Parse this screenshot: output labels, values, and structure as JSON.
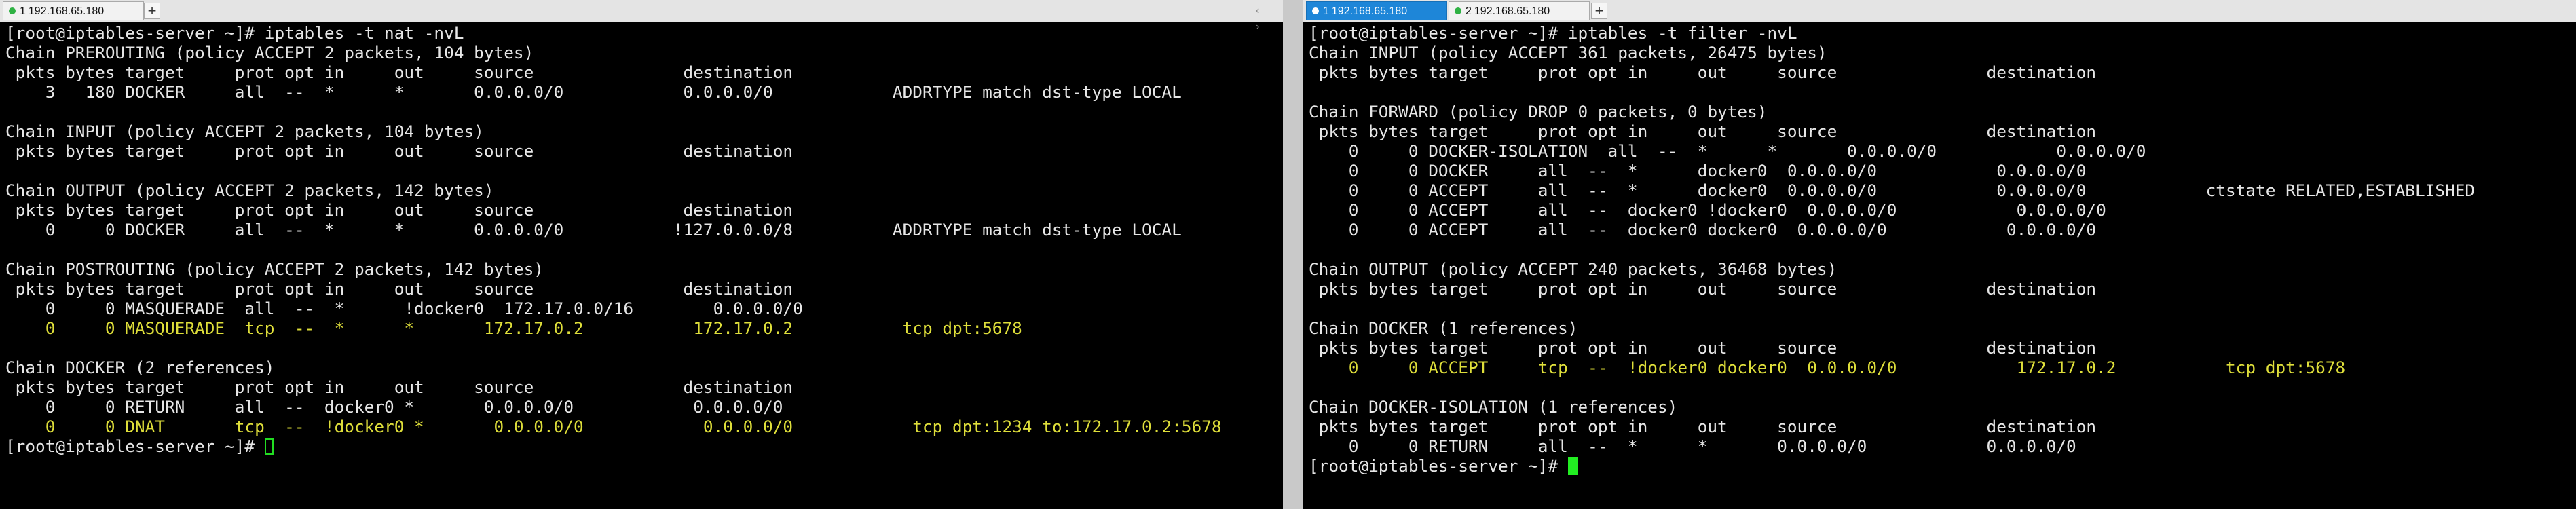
{
  "left_session": {
    "tabs": [
      {
        "number": "1",
        "label": "192.168.65.180",
        "active": false
      }
    ],
    "add_tab": "+",
    "nav_arrows": "‹ ›",
    "terminal_lines": [
      {
        "text": "[root@iptables-server ~]# iptables -t nat -nvL",
        "highlight": false
      },
      {
        "text": "Chain PREROUTING (policy ACCEPT 2 packets, 104 bytes)",
        "highlight": false
      },
      {
        "text": " pkts bytes target     prot opt in     out     source               destination",
        "highlight": false
      },
      {
        "text": "    3   180 DOCKER     all  --  *      *       0.0.0.0/0            0.0.0.0/0            ADDRTYPE match dst-type LOCAL",
        "highlight": false
      },
      {
        "text": "",
        "highlight": false
      },
      {
        "text": "Chain INPUT (policy ACCEPT 2 packets, 104 bytes)",
        "highlight": false
      },
      {
        "text": " pkts bytes target     prot opt in     out     source               destination",
        "highlight": false
      },
      {
        "text": "",
        "highlight": false
      },
      {
        "text": "Chain OUTPUT (policy ACCEPT 2 packets, 142 bytes)",
        "highlight": false
      },
      {
        "text": " pkts bytes target     prot opt in     out     source               destination",
        "highlight": false
      },
      {
        "text": "    0     0 DOCKER     all  --  *      *       0.0.0.0/0           !127.0.0.0/8          ADDRTYPE match dst-type LOCAL",
        "highlight": false
      },
      {
        "text": "",
        "highlight": false
      },
      {
        "text": "Chain POSTROUTING (policy ACCEPT 2 packets, 142 bytes)",
        "highlight": false
      },
      {
        "text": " pkts bytes target     prot opt in     out     source               destination",
        "highlight": false
      },
      {
        "text": "    0     0 MASQUERADE  all  --  *      !docker0  172.17.0.0/16        0.0.0.0/0",
        "highlight": false
      },
      {
        "text": "    0     0 MASQUERADE  tcp  --  *      *       172.17.0.2           172.17.0.2           tcp dpt:5678",
        "highlight": true
      },
      {
        "text": "",
        "highlight": false
      },
      {
        "text": "Chain DOCKER (2 references)",
        "highlight": false
      },
      {
        "text": " pkts bytes target     prot opt in     out     source               destination",
        "highlight": false
      },
      {
        "text": "    0     0 RETURN     all  --  docker0 *       0.0.0.0/0            0.0.0.0/0",
        "highlight": false
      },
      {
        "text": "    0     0 DNAT       tcp  --  !docker0 *       0.0.0.0/0            0.0.0.0/0            tcp dpt:1234 to:172.17.0.2:5678",
        "highlight": true
      }
    ],
    "prompt": "[root@iptables-server ~]# "
  },
  "right_session": {
    "tabs": [
      {
        "number": "1",
        "label": "192.168.65.180",
        "active": true
      },
      {
        "number": "2",
        "label": "192.168.65.180",
        "active": false
      }
    ],
    "add_tab": "+",
    "terminal_lines": [
      {
        "text": "[root@iptables-server ~]# iptables -t filter -nvL",
        "highlight": false
      },
      {
        "text": "Chain INPUT (policy ACCEPT 361 packets, 26475 bytes)",
        "highlight": false
      },
      {
        "text": " pkts bytes target     prot opt in     out     source               destination",
        "highlight": false
      },
      {
        "text": "",
        "highlight": false
      },
      {
        "text": "Chain FORWARD (policy DROP 0 packets, 0 bytes)",
        "highlight": false
      },
      {
        "text": " pkts bytes target     prot opt in     out     source               destination",
        "highlight": false
      },
      {
        "text": "    0     0 DOCKER-ISOLATION  all  --  *      *       0.0.0.0/0            0.0.0.0/0",
        "highlight": false
      },
      {
        "text": "    0     0 DOCKER     all  --  *      docker0  0.0.0.0/0            0.0.0.0/0",
        "highlight": false
      },
      {
        "text": "    0     0 ACCEPT     all  --  *      docker0  0.0.0.0/0            0.0.0.0/0            ctstate RELATED,ESTABLISHED",
        "highlight": false
      },
      {
        "text": "    0     0 ACCEPT     all  --  docker0 !docker0  0.0.0.0/0            0.0.0.0/0",
        "highlight": false
      },
      {
        "text": "    0     0 ACCEPT     all  --  docker0 docker0  0.0.0.0/0            0.0.0.0/0",
        "highlight": false
      },
      {
        "text": "",
        "highlight": false
      },
      {
        "text": "Chain OUTPUT (policy ACCEPT 240 packets, 36468 bytes)",
        "highlight": false
      },
      {
        "text": " pkts bytes target     prot opt in     out     source               destination",
        "highlight": false
      },
      {
        "text": "",
        "highlight": false
      },
      {
        "text": "Chain DOCKER (1 references)",
        "highlight": false
      },
      {
        "text": " pkts bytes target     prot opt in     out     source               destination",
        "highlight": false
      },
      {
        "text": "    0     0 ACCEPT     tcp  --  !docker0 docker0  0.0.0.0/0            172.17.0.2           tcp dpt:5678",
        "highlight": true
      },
      {
        "text": "",
        "highlight": false
      },
      {
        "text": "Chain DOCKER-ISOLATION (1 references)",
        "highlight": false
      },
      {
        "text": " pkts bytes target     prot opt in     out     source               destination",
        "highlight": false
      },
      {
        "text": "    0     0 RETURN     all  --  *      *       0.0.0.0/0            0.0.0.0/0",
        "highlight": false
      }
    ],
    "prompt": "[root@iptables-server ~]# "
  },
  "colors": {
    "terminal_bg": "#000000",
    "terminal_text": "#e6e6e6",
    "highlight_text": "#dede3a",
    "cursor": "#22ee22",
    "active_tab": "#1e86d8",
    "tab_dot": "#2fb244"
  }
}
